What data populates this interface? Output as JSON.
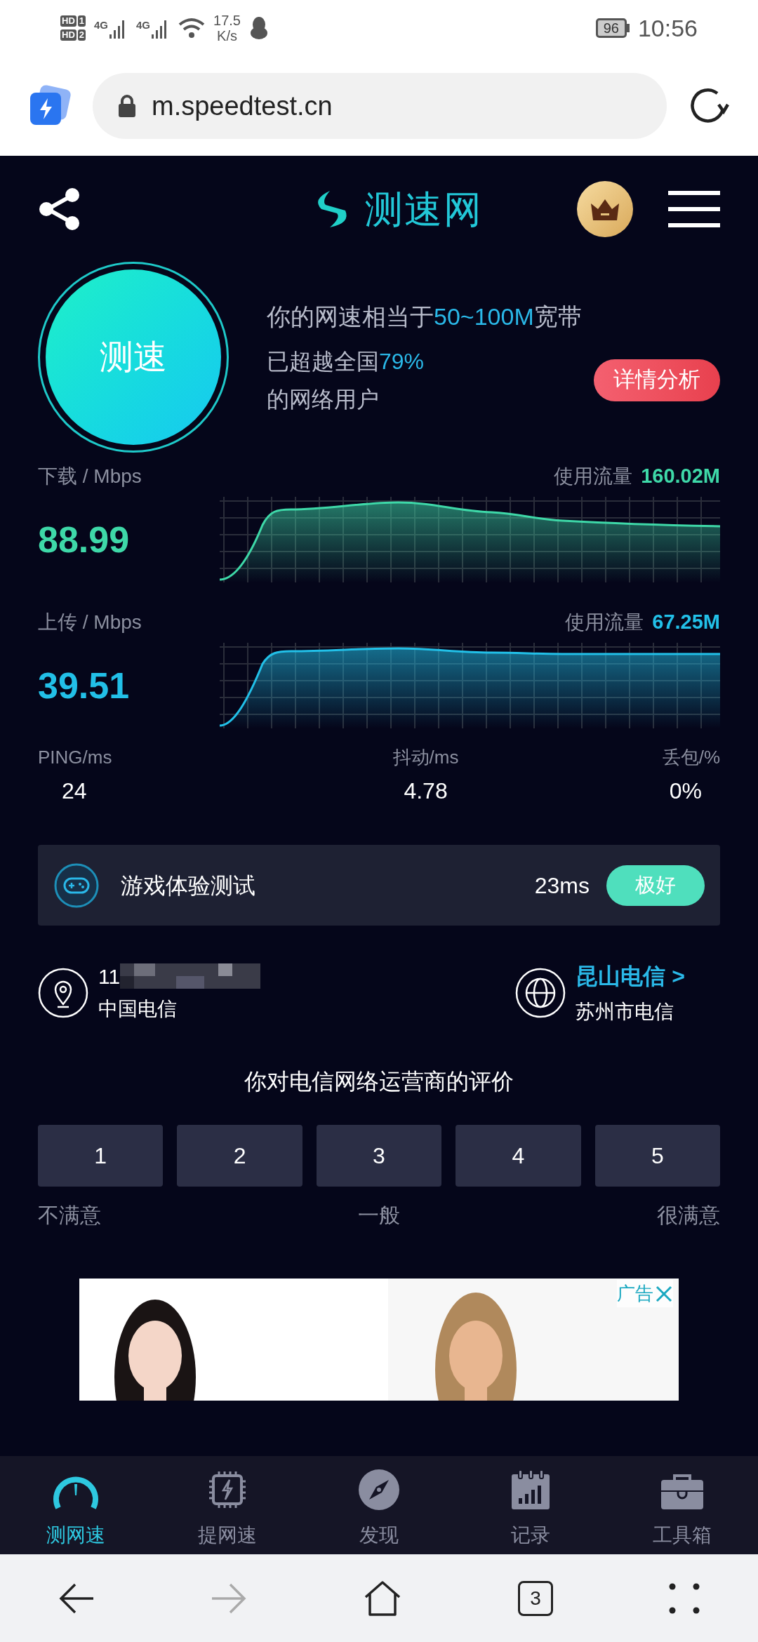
{
  "status_bar": {
    "sims": [
      {
        "label": "HD",
        "slot": "1"
      },
      {
        "label": "HD",
        "slot": "2"
      }
    ],
    "networks": [
      "4G",
      "4G"
    ],
    "speed": "17.5",
    "speed_unit": "K/s",
    "battery": "96",
    "time": "10:56"
  },
  "browser": {
    "url": "m.speedtest.cn"
  },
  "header": {
    "logo": "测速网"
  },
  "speed_button": {
    "label": "测速"
  },
  "summary": {
    "line1": {
      "prefix": "你的网速相当于",
      "highlight": "50~100M",
      "suffix": "宽带"
    },
    "line2": {
      "prefix": "已超越全国",
      "highlight": "79%"
    },
    "line3": "的网络用户",
    "details_button": "详情分析"
  },
  "meters": [
    {
      "label": "下载 / Mbps",
      "value": "88.99",
      "usage_label": "使用流量",
      "usage": "160.02M"
    },
    {
      "label": "上传 / Mbps",
      "value": "39.51",
      "usage_label": "使用流量",
      "usage": "67.25M"
    }
  ],
  "stats": [
    {
      "label": "PING/ms",
      "value": "24"
    },
    {
      "label": "抖动/ms",
      "value": "4.78"
    },
    {
      "label": "丢包/%",
      "value": "0%"
    }
  ],
  "game_test": {
    "title": "游戏体验测试",
    "latency": "23ms",
    "rating": "极好"
  },
  "location": {
    "ip": "11",
    "isp": "中国电信"
  },
  "server": {
    "name": "昆山电信 >",
    "region": "苏州市电信"
  },
  "rating": {
    "question": "你对电信网络运营商的评价",
    "options": [
      {
        "label": "1"
      },
      {
        "label": "2"
      },
      {
        "label": "3"
      },
      {
        "label": "4"
      },
      {
        "label": "5"
      }
    ],
    "scale": [
      "不满意",
      "一般",
      "很满意"
    ]
  },
  "ad": {
    "kind": "picture",
    "label": "广告"
  },
  "bottom_nav": [
    {
      "label": "测网速",
      "selected": true
    },
    {
      "label": "提网速",
      "selected": false
    },
    {
      "label": "发现",
      "selected": false
    },
    {
      "label": "记录",
      "selected": false
    },
    {
      "label": "工具箱",
      "selected": false
    }
  ],
  "browser_nav": {
    "back": {
      "disabled": false
    },
    "forward": {
      "disabled": true
    },
    "tabs_count": "3"
  }
}
